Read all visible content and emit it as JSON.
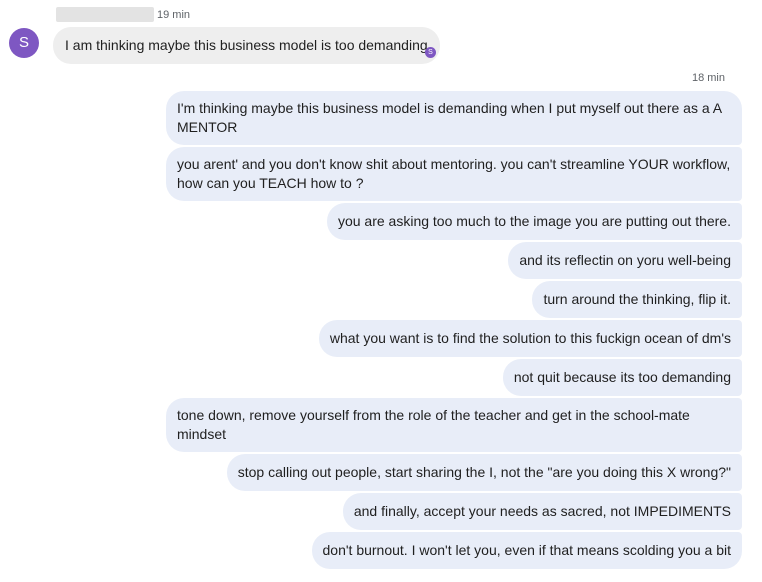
{
  "conversation": {
    "contact": {
      "initial": "S"
    },
    "incoming": {
      "timestamp": "19 min",
      "message": "I am thinking maybe this business model is too demanding",
      "read_receipt_initial": "S"
    },
    "outgoing": {
      "timestamp": "18 min",
      "messages": [
        "I'm thinking maybe this business model is demanding when I put myself out there as a A MENTOR",
        "you arent' and you don't know shit about mentoring. you can't streamline YOUR workflow, how can you TEACH how to ?",
        "you are asking too much to the image you are putting out there.",
        "and its reflectin on yoru well-being",
        "turn around the thinking, flip it.",
        "what you want is to find the solution to this fuckign ocean of dm's",
        "not quit because its too demanding",
        "tone down, remove yourself from the role of the teacher and get in the school-mate mindset",
        "stop calling out people, start sharing the I, not the \"are you doing this X wrong?\"",
        "and finally, accept your needs as sacred, not IMPEDIMENTS",
        "don't burnout. I won't let you, even if that means scolding you a bit"
      ]
    }
  }
}
